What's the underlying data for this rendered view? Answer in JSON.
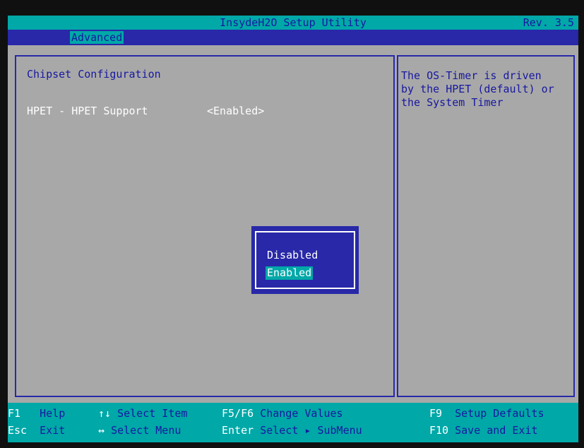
{
  "header": {
    "title": "InsydeH2O Setup Utility",
    "revision": "Rev. 3.5"
  },
  "menu": {
    "tabs": [
      "Advanced"
    ]
  },
  "main": {
    "section_title": "Chipset Configuration",
    "setting": {
      "label": "HPET - HPET Support",
      "value": "<Enabled>"
    }
  },
  "help": {
    "text": "The OS-Timer is driven\nby the HPET (default) or\nthe System Timer"
  },
  "popup": {
    "options": [
      "Disabled",
      "Enabled"
    ],
    "selected": "Enabled"
  },
  "footer": {
    "row1": [
      {
        "key": "F1",
        "desc": "Help"
      },
      {
        "key": "↑↓",
        "desc": "Select Item"
      },
      {
        "key": "F5/F6",
        "desc": "Change Values"
      },
      {
        "key": "F9",
        "desc": "Setup Defaults"
      }
    ],
    "row2": [
      {
        "key": "Esc",
        "desc": "Exit"
      },
      {
        "key": "↔",
        "desc": "Select Menu"
      },
      {
        "key": "Enter",
        "desc": "Select ▸ SubMenu"
      },
      {
        "key": "F10",
        "desc": "Save and Exit"
      }
    ]
  },
  "colors": {
    "title_bar": "#00a8a8",
    "menu_bar": "#2828a8",
    "pane_background": "#a8a8a8",
    "accent_text": "#1818a0",
    "highlight_text": "#ffffff"
  }
}
